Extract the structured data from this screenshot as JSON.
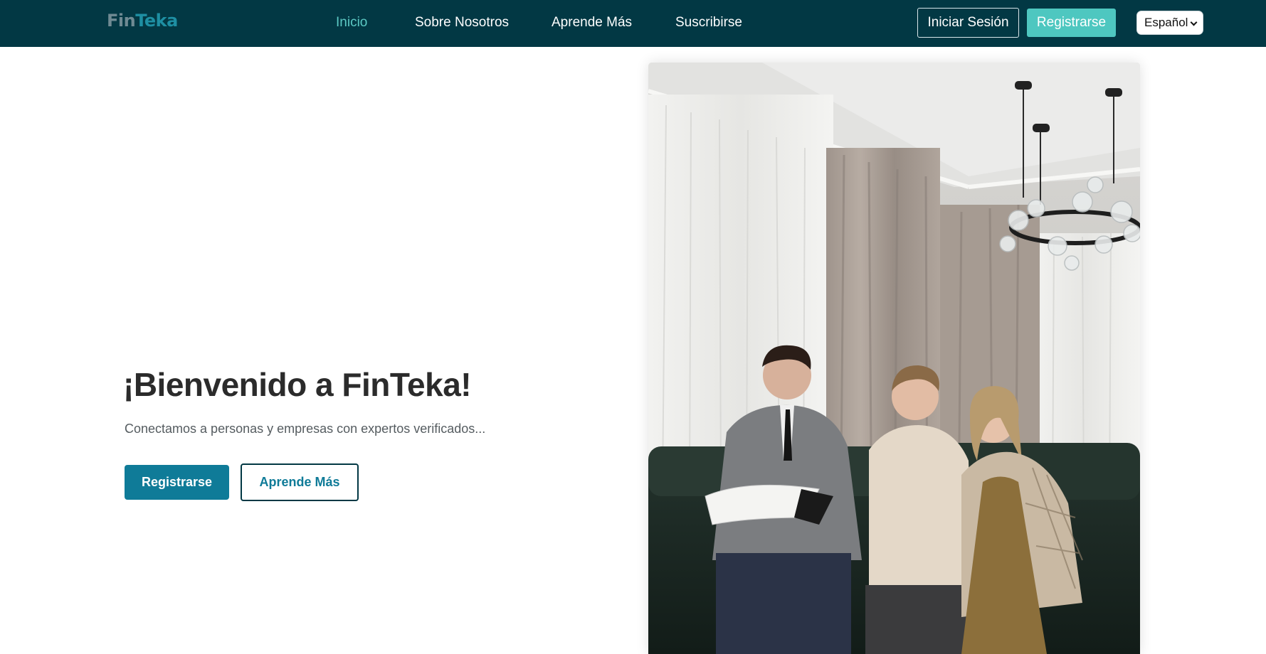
{
  "header": {
    "logo": {
      "part1": "Fin",
      "part2": "Teka"
    },
    "nav": [
      {
        "label": "Inicio",
        "active": true
      },
      {
        "label": "Sobre Nosotros",
        "active": false
      },
      {
        "label": "Aprende Más",
        "active": false
      },
      {
        "label": "Suscribirse",
        "active": false
      }
    ],
    "login_label": "Iniciar Sesión",
    "register_label": "Registrarse",
    "language": {
      "selected": "Español",
      "icon": "chevron-down-icon"
    }
  },
  "hero": {
    "title": "¡Bienvenido a FinTeka!",
    "subtitle": "Conectamos a personas y empresas con expertos verificados...",
    "primary_button": "Registrarse",
    "secondary_button": "Aprende Más",
    "image_alt": "Asesor financiero mostrando un documento a una pareja sentada en un sofá"
  },
  "colors": {
    "header_bg": "#023844",
    "accent": "#4ec7c0",
    "active_nav": "#5cc9c4",
    "primary_button": "#0f7b98"
  }
}
